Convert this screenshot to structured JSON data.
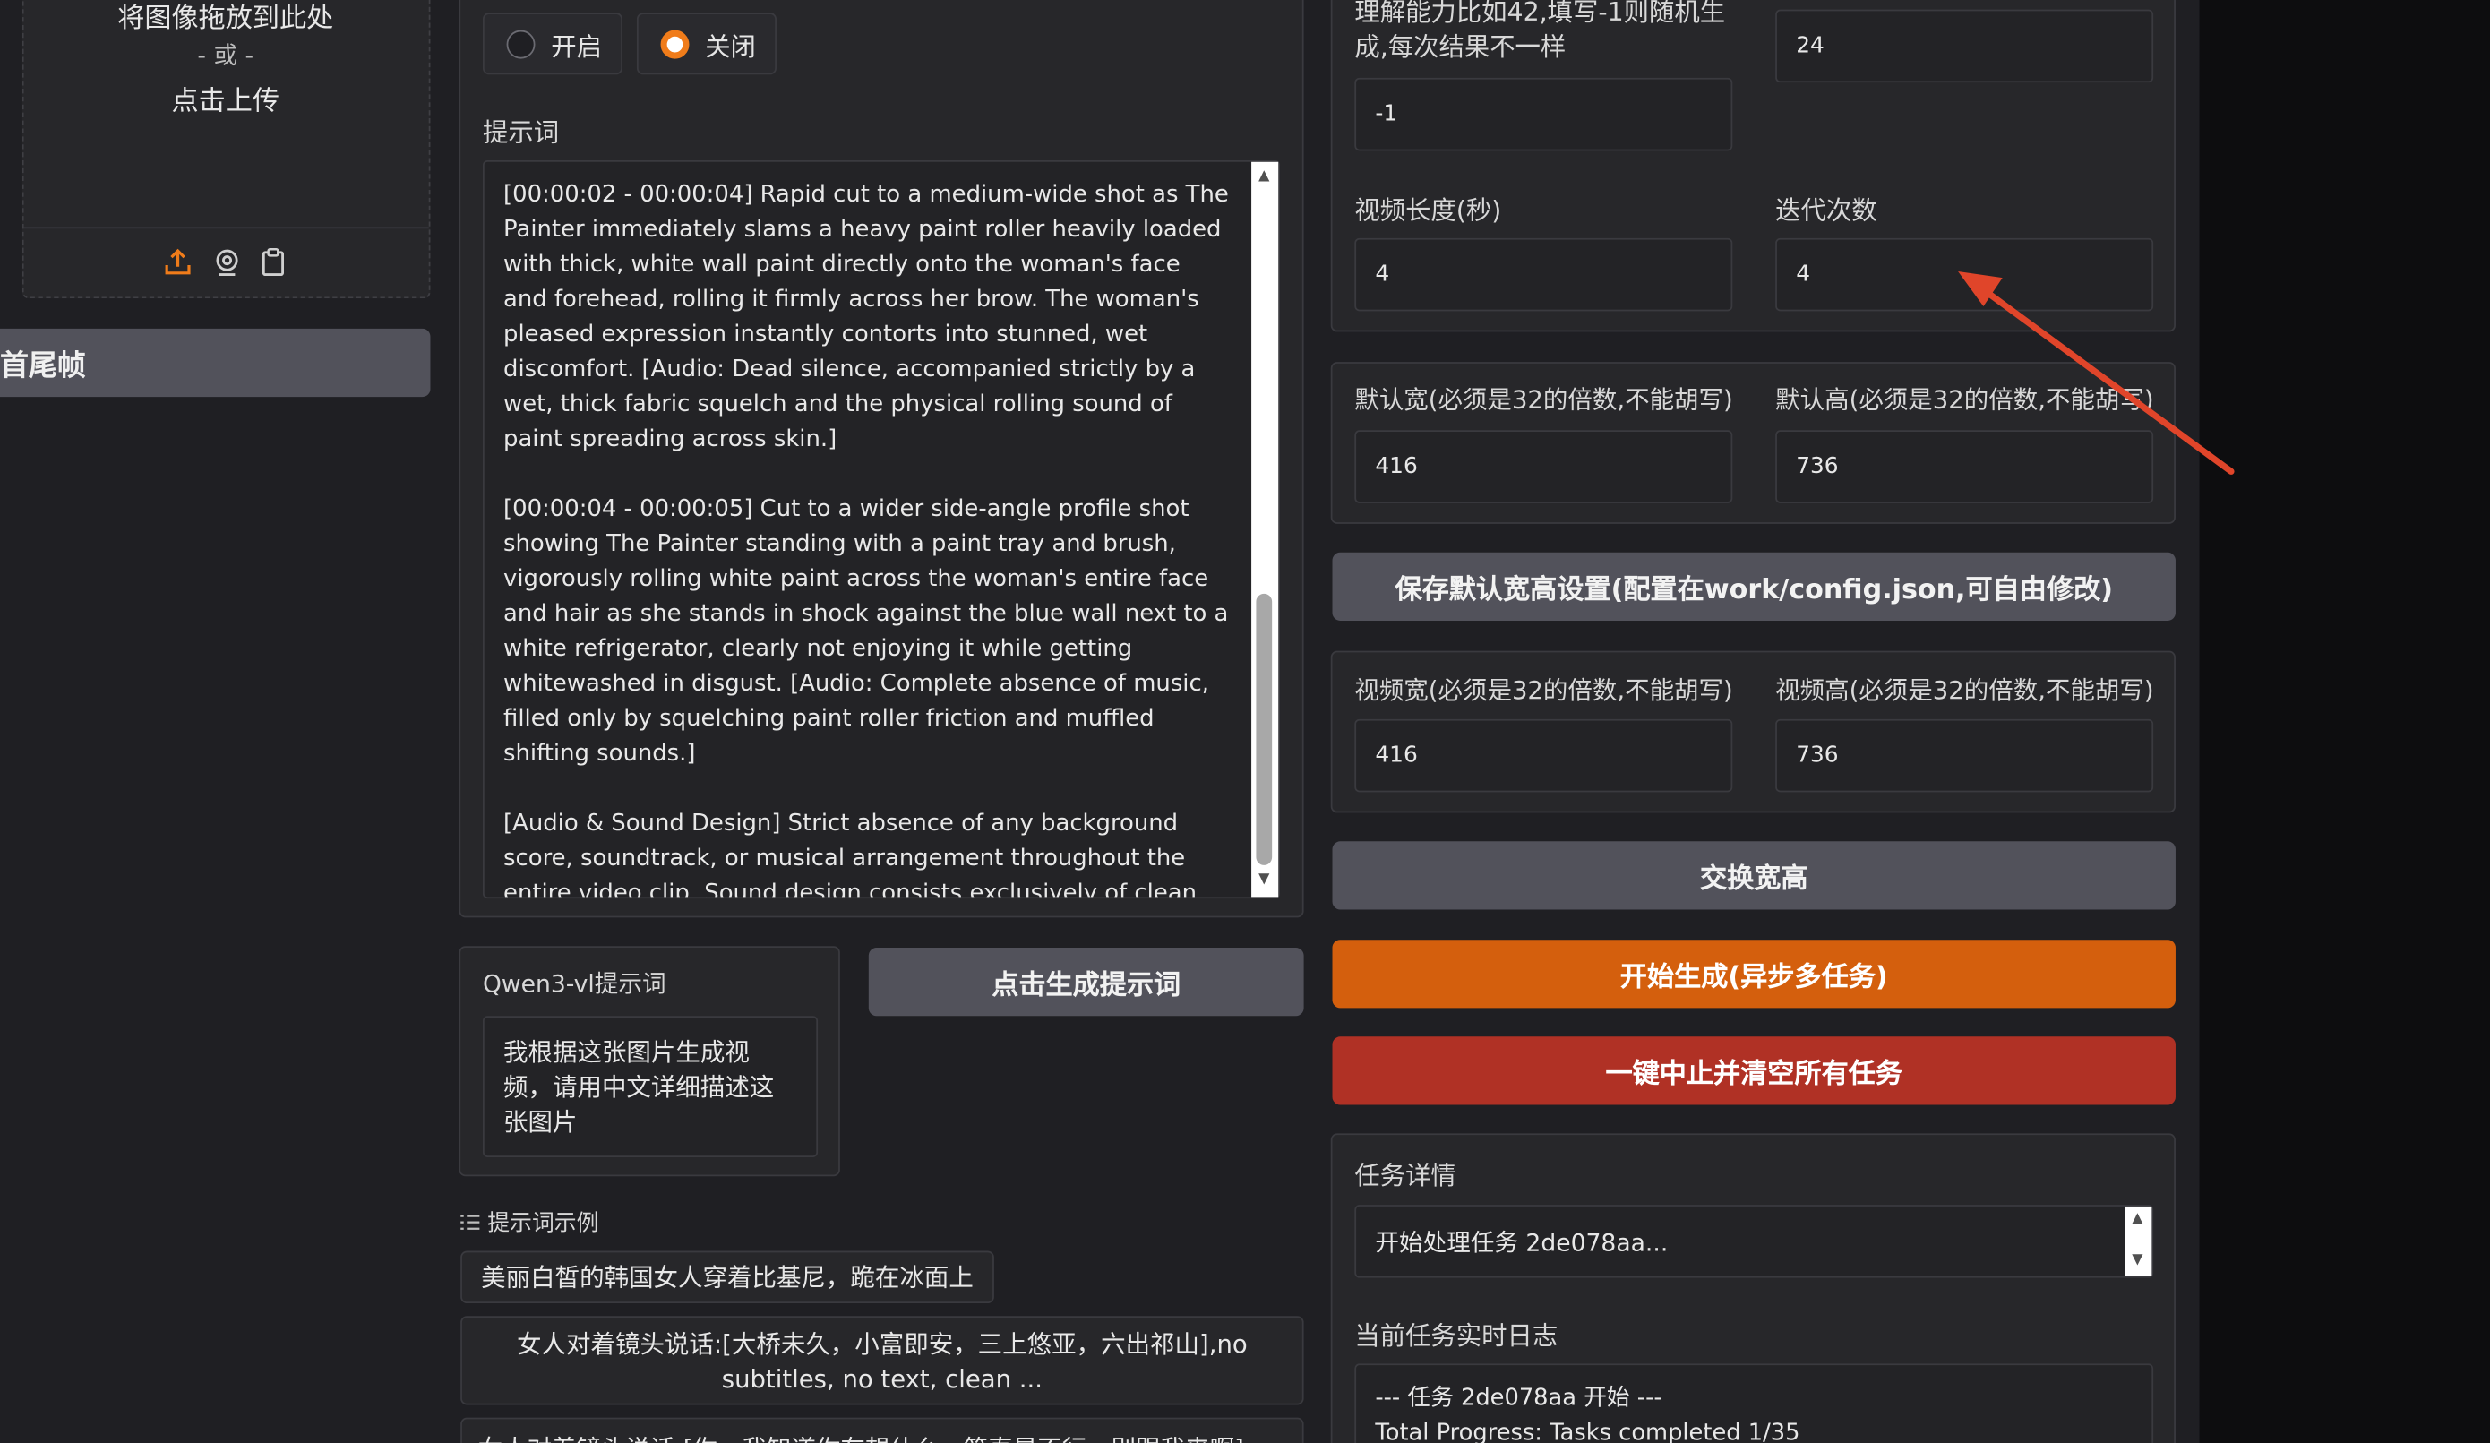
{
  "upload": {
    "drop_text": "将图像拖放到此处",
    "or_text": "- 或 -",
    "click_text": "点击上传",
    "icons": [
      "upload-icon",
      "webcam-icon",
      "clipboard-icon"
    ]
  },
  "sidebar": {
    "active_tab": "首尾帧"
  },
  "toggle": {
    "on_label": "开启",
    "off_label": "关闭",
    "selected": "关闭"
  },
  "prompt": {
    "label": "提示词",
    "paragraphs": [
      "[00:00:02 - 00:00:04] Rapid cut to a medium-wide shot as The Painter immediately slams a heavy paint roller heavily loaded with thick, white wall paint directly onto the woman's face and forehead, rolling it firmly across her brow. The woman's pleased expression instantly contorts into stunned, wet discomfort. [Audio: Dead silence, accompanied strictly by a wet, thick fabric squelch and the physical rolling sound of paint spreading across skin.]",
      "[00:00:04 - 00:00:05] Cut to a wider side-angle profile shot showing The Painter standing with a paint tray and brush, vigorously rolling white paint across the woman's entire face and hair as she stands in shock against the blue wall next to a white refrigerator, clearly not enjoying it while getting whitewashed in disgust. [Audio: Complete absence of music, filled only by squelching paint roller friction and muffled shifting sounds.]",
      "[Audio & Sound Design] Strict absence of any background score, soundtrack, or musical arrangement throughout the entire video clip. Sound design consists exclusively of clean indoor room tone, close-mic speech recording, and physical wet paint application foley effects."
    ]
  },
  "qwen": {
    "label": "Qwen3-vl提示词",
    "value": "我根据这张图片生成视频，请用中文详细描述这张图片",
    "generate_button": "点击生成提示词"
  },
  "examples": {
    "label": "提示词示例",
    "items": [
      "美丽白皙的韩国女人穿着比基尼，跪在冰面上",
      "女人对着镜头说话:[大桥未久，小富即安，三上悠亚，六出祁山],no subtitles, no text, clean ...",
      "女人对着镜头说话:[你，我知道你在想什么，简直是不行，别跟我来啊] no ..."
    ]
  },
  "settings": {
    "seed_label": "理解能力比如42,填写-1则随机生成,每次结果不一样",
    "seed_value": "-1",
    "top_right_value": "24",
    "video_length_label": "视频长度(秒)",
    "video_length_value": "4",
    "iterations_label": "迭代次数",
    "iterations_value": "4",
    "default_width_label": "默认宽(必须是32的倍数,不能胡写)",
    "default_width_value": "416",
    "default_height_label": "默认高(必须是32的倍数,不能胡写)",
    "default_height_value": "736",
    "save_defaults_button": "保存默认宽高设置(配置在work/config.json,可自由修改)",
    "video_width_label": "视频宽(必须是32的倍数,不能胡写)",
    "video_width_value": "416",
    "video_height_label": "视频高(必须是32的倍数,不能胡写)",
    "video_height_value": "736",
    "swap_button": "交换宽高",
    "start_button": "开始生成(异步多任务)",
    "stop_button": "一键中止并清空所有任务"
  },
  "tasks": {
    "detail_label": "任务详情",
    "detail_value": "开始处理任务 2de078aa...",
    "log_label": "当前任务实时日志",
    "log_lines": [
      "--- 任务 2de078aa 开始 ---",
      "Total Progress: Tasks completed 1/35"
    ]
  },
  "colors": {
    "background": "#1f1f23",
    "panel": "#27272a",
    "accent_orange": "#d45f0d",
    "danger_red": "#b03125",
    "button_gray": "#52525b",
    "annotation_arrow": "#e0452a"
  }
}
